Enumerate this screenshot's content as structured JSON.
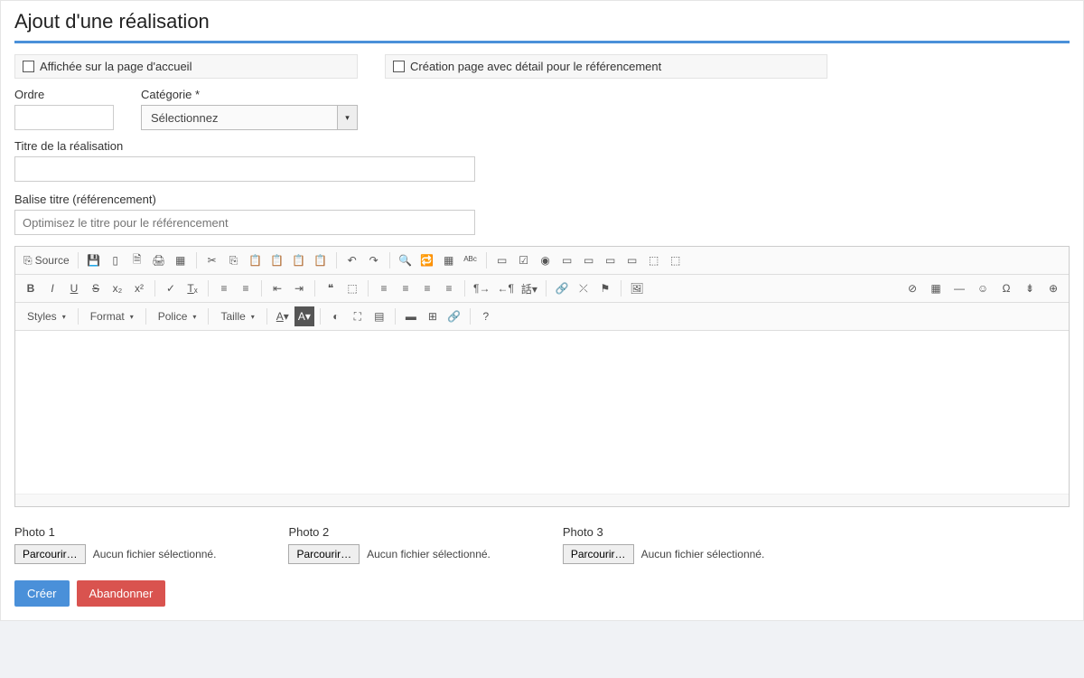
{
  "title": "Ajout d'une réalisation",
  "checkboxes": {
    "homepage": "Affichée sur la page d'accueil",
    "seo_page": "Création page avec détail pour le référencement"
  },
  "fields": {
    "order_label": "Ordre",
    "category_label": "Catégorie *",
    "category_placeholder": "Sélectionnez",
    "title_label": "Titre de la réalisation",
    "seo_title_label": "Balise titre (référencement)",
    "seo_title_placeholder": "Optimisez le titre pour le référencement"
  },
  "editor": {
    "source": "Source",
    "styles": "Styles",
    "format": "Format",
    "font": "Police",
    "size": "Taille"
  },
  "photos": {
    "photo1": "Photo 1",
    "photo2": "Photo 2",
    "photo3": "Photo 3",
    "browse": "Parcourir…",
    "no_file": "Aucun fichier sélectionné."
  },
  "buttons": {
    "create": "Créer",
    "cancel": "Abandonner"
  }
}
